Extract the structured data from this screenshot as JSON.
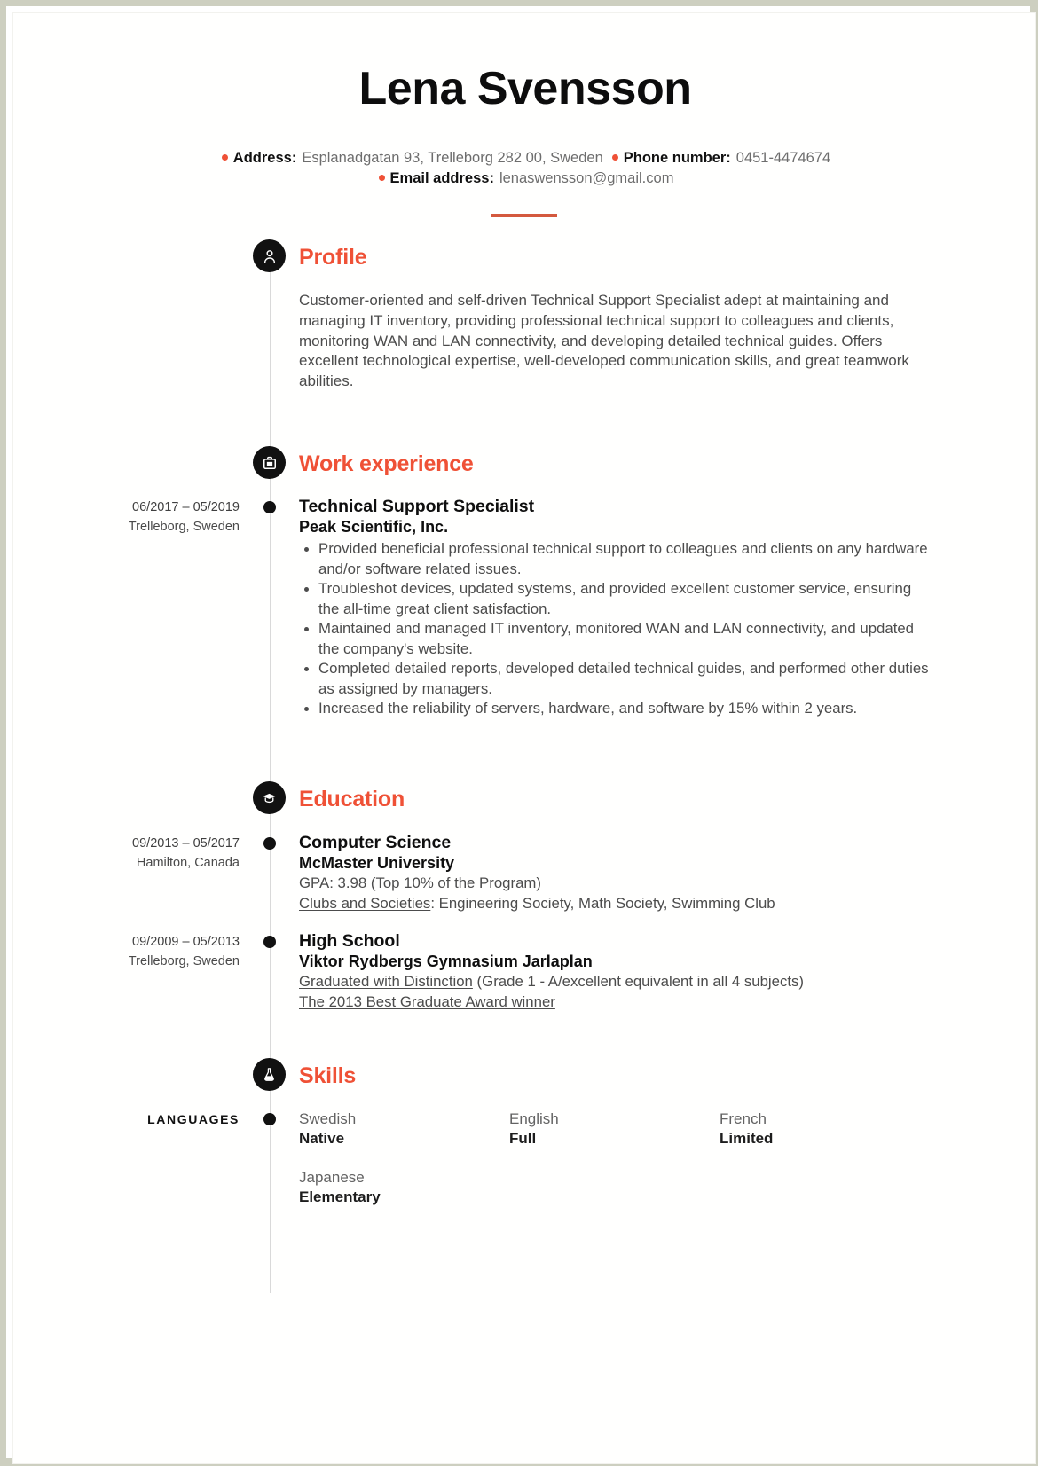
{
  "header": {
    "name": "Lena Svensson",
    "contacts": [
      {
        "label": "Address:",
        "value": "Esplanadgatan 93, Trelleborg 282 00, Sweden"
      },
      {
        "label": "Phone number:",
        "value": "0451-4474674"
      },
      {
        "label": "Email address:",
        "value": "lenaswensson@gmail.com"
      }
    ]
  },
  "colors": {
    "accent": "#ef5136",
    "rule": "#d4593e",
    "icon_bg": "#111111",
    "timeline": "#d9d9d9",
    "page_border": "#cdcfc0"
  },
  "sections": {
    "profile": {
      "title": "Profile",
      "icon": "person-icon",
      "text": "Customer-oriented and self-driven Technical Support Specialist adept at maintaining and managing IT inventory, providing professional technical support to colleagues and clients, monitoring WAN and LAN connectivity, and developing detailed technical guides. Offers excellent technological expertise, well-developed communication skills, and great teamwork abilities."
    },
    "work": {
      "title": "Work experience",
      "icon": "briefcase-icon",
      "entries": [
        {
          "dates": "06/2017 – 05/2019",
          "location": "Trelleborg, Sweden",
          "role": "Technical Support Specialist",
          "company": "Peak Scientific, Inc.",
          "bullets": [
            "Provided beneficial professional technical support to colleagues and clients on any hardware and/or software related issues.",
            "Troubleshot devices, updated systems, and provided excellent customer service, ensuring the all-time great client satisfaction.",
            "Maintained and managed IT inventory, monitored WAN and LAN connectivity, and updated the company's website.",
            "Completed detailed reports, developed detailed technical guides, and performed other duties as assigned by managers.",
            "Increased the reliability of servers, hardware, and software by 15% within 2 years."
          ]
        }
      ]
    },
    "education": {
      "title": "Education",
      "icon": "graduation-cap-icon",
      "entries": [
        {
          "dates": "09/2013 – 05/2017",
          "location": "Hamilton, Canada",
          "degree": "Computer Science",
          "school": "McMaster University",
          "details": [
            {
              "label": "GPA",
              "value": ": 3.98 (Top 10% of the Program)"
            },
            {
              "label": "Clubs and Societies",
              "value": ": Engineering Society, Math Society, Swimming Club"
            }
          ]
        },
        {
          "dates": "09/2009 – 05/2013",
          "location": "Trelleborg, Sweden",
          "degree": "High School",
          "school": "Viktor Rydbergs Gymnasium Jarlaplan",
          "details": [
            {
              "label": "Graduated with Distinction",
              "value": " (Grade 1 - A/excellent equivalent in all 4 subjects)"
            },
            {
              "label": "The 2013 Best Graduate Award winner",
              "value": ""
            }
          ]
        }
      ]
    },
    "skills": {
      "title": "Skills",
      "icon": "flask-icon",
      "category_label": "LANGUAGES",
      "languages": [
        {
          "name": "Swedish",
          "level": "Native"
        },
        {
          "name": "English",
          "level": "Full"
        },
        {
          "name": "French",
          "level": "Limited"
        },
        {
          "name": "Japanese",
          "level": "Elementary"
        }
      ]
    }
  }
}
